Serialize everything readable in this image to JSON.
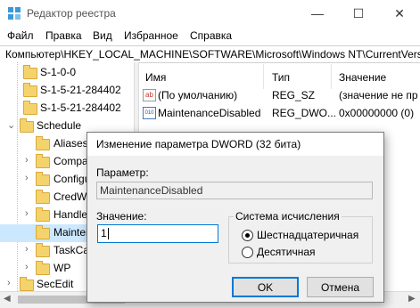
{
  "window": {
    "title": "Редактор реестра",
    "minimize": "—",
    "maximize": "☐",
    "close": "✕"
  },
  "menu": [
    "Файл",
    "Правка",
    "Вид",
    "Избранное",
    "Справка"
  ],
  "address": "Компьютер\\HKEY_LOCAL_MACHINE\\SOFTWARE\\Microsoft\\Windows NT\\CurrentVersi",
  "tree": {
    "sids": [
      "S-1-0-0",
      "S-1-5-21-284402",
      "S-1-5-21-284402"
    ],
    "schedule": "Schedule",
    "children": [
      "Aliases",
      "Compa",
      "Configu",
      "CredWo",
      "Handle",
      "Mainten",
      "TaskCa",
      "WP"
    ],
    "secedit": "SecEdit"
  },
  "list": {
    "headers": {
      "name": "Имя",
      "type": "Тип",
      "value": "Значение"
    },
    "rows": [
      {
        "icon": "ab",
        "name": "(По умолчанию)",
        "type": "REG_SZ",
        "value": "(значение не пр"
      },
      {
        "icon": "010",
        "name": "MaintenanceDisabled",
        "type": "REG_DWO...",
        "value": "0x00000000 (0)"
      }
    ]
  },
  "dialog": {
    "title": "Изменение параметра DWORD (32 бита)",
    "param_label": "Параметр:",
    "param_value": "MaintenanceDisabled",
    "value_label": "Значение:",
    "value": "1",
    "radix_label": "Система исчисления",
    "radix_options": [
      "Шестнадцатеричная",
      "Десятичная"
    ],
    "radix_selected": "Шестнадцатеричная",
    "ok": "OK",
    "cancel": "Отмена"
  }
}
